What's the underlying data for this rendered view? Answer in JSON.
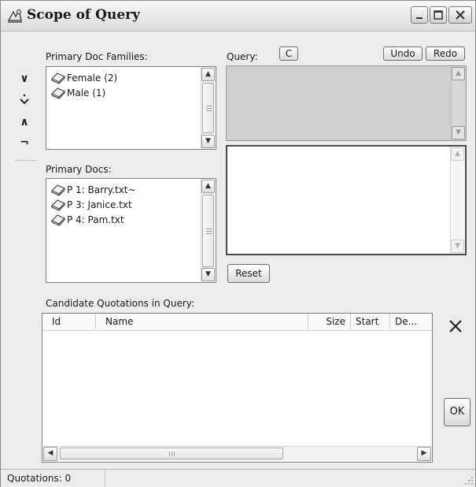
{
  "window": {
    "title": "Scope of Query"
  },
  "families": {
    "label": "Primary Doc Families:",
    "items": [
      {
        "label": "Female (2)"
      },
      {
        "label": "Male (1)"
      }
    ]
  },
  "docs": {
    "label": "Primary Docs:",
    "items": [
      {
        "label": "P 1: Barry.txt~"
      },
      {
        "label": "P 3: Janice.txt"
      },
      {
        "label": "P 4: Pam.txt"
      }
    ]
  },
  "query": {
    "label": "Query:",
    "clear_label": "C",
    "undo_label": "Undo",
    "redo_label": "Redo",
    "reset_label": "Reset"
  },
  "candidates": {
    "label": "Candidate Quotations in Query:",
    "columns": [
      "Id",
      "Name",
      "Size",
      "Start",
      "De..."
    ]
  },
  "buttons": {
    "ok_label": "OK"
  },
  "status": {
    "text": "Quotations: 0"
  }
}
